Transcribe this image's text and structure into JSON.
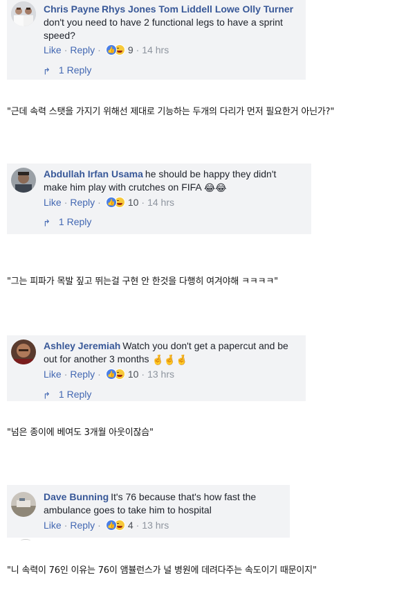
{
  "comments": [
    {
      "author": "Chris Payne",
      "tagged": "Rhys Jones Tom Liddell Lowe Olly Turner",
      "text": "don't you need to have 2 functional legs to have a sprint speed?",
      "like": "Like",
      "reply": "Reply",
      "count": "9",
      "time": "14 hrs",
      "replies": "1 Reply",
      "translation": "\"근데 속력 스탯을 가지기 위해선 제대로 기능하는 두개의 다리가 먼저 필요한거 아닌가?\""
    },
    {
      "author": "Abdullah Irfan Usama",
      "text": "he should be happy they didn't make him play with crutches on FIFA",
      "emoji": "😂😂",
      "like": "Like",
      "reply": "Reply",
      "count": "10",
      "time": "14 hrs",
      "replies": "1 Reply",
      "translation": "\"그는 피파가 목발 짚고 뛰는걸 구현 안 한것을 다행히 여겨야해 ㅋㅋㅋㅋ\""
    },
    {
      "author": "Ashley Jeremiah",
      "text": "Watch you don't get a papercut and be out for another 3 months",
      "emoji": "🤞🤞🤞",
      "like": "Like",
      "reply": "Reply",
      "count": "10",
      "time": "13 hrs",
      "replies": "1 Reply",
      "translation": "\"넘은 종이에 베여도 3개월 아웃이잖슴\""
    },
    {
      "author": "Dave Bunning",
      "text": "It's 76 because that's how fast the ambulance goes to take him to hospital",
      "like": "Like",
      "reply": "Reply",
      "count": "4",
      "time": "13 hrs",
      "translation": "\"니 속력이 76인 이유는 76이 앰뷸런스가 널 병원에 데려다주는 속도이기 때문이지\""
    }
  ],
  "icons": {
    "reaction_like": "thumbs-up-icon",
    "reaction_haha": "laughing-face-icon",
    "reply_arrow": "reply-arrow-icon"
  },
  "colors": {
    "link": "#385898",
    "action": "#4267b2",
    "card_bg": "#f2f3f5",
    "meta": "#8d949e"
  }
}
